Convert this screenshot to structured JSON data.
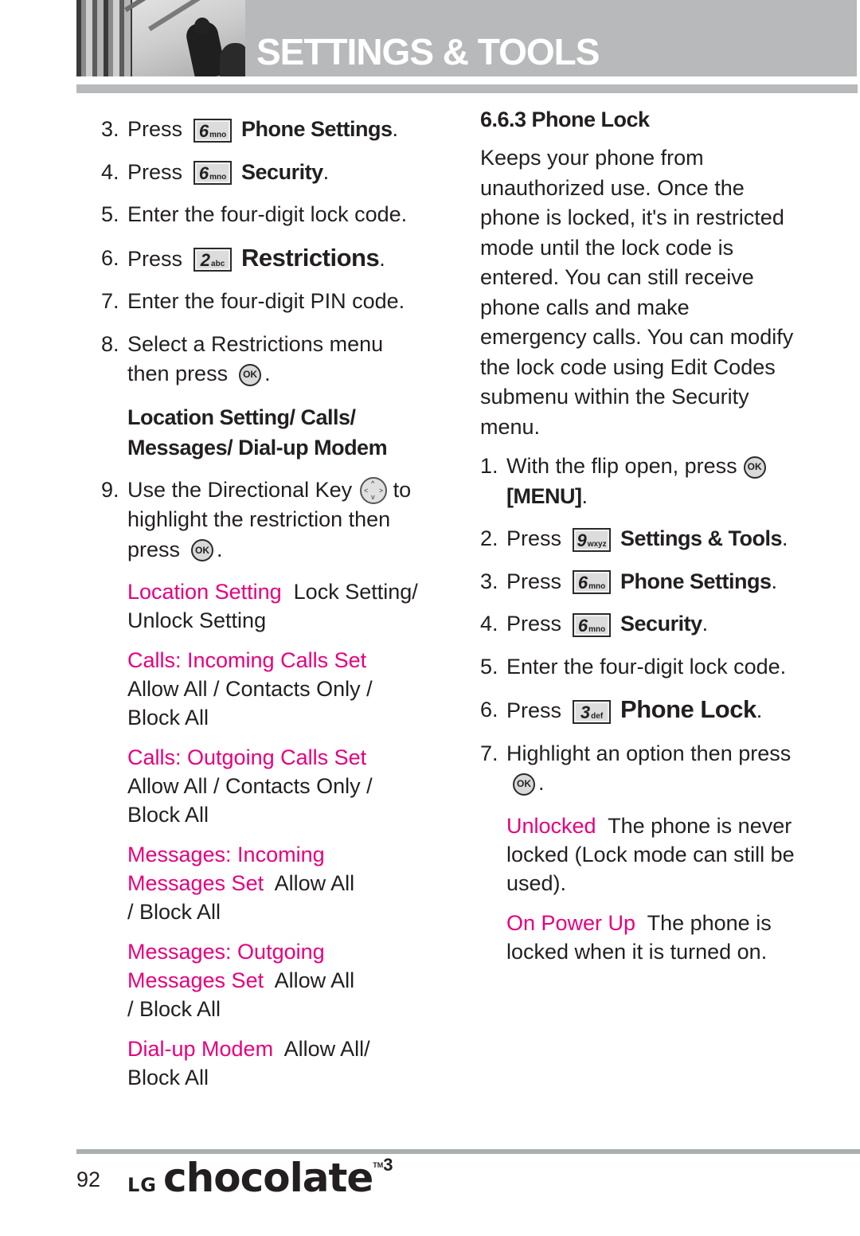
{
  "header": {
    "title": "SETTINGS & TOOLS"
  },
  "left_column": {
    "steps_a": [
      {
        "num": "3.",
        "press": "Press",
        "key_digit": "6",
        "key_letters": "mno",
        "target": "Phone Settings",
        "end": "."
      },
      {
        "num": "4.",
        "press": "Press",
        "key_digit": "6",
        "key_letters": "mno",
        "target": "Security",
        "end": "."
      }
    ],
    "step5": {
      "num": "5.",
      "text": "Enter the four-digit lock code."
    },
    "step6": {
      "num": "6.",
      "press": "Press",
      "key_digit": "2",
      "key_letters": "abc",
      "target": "Restrictions",
      "end": "."
    },
    "step7": {
      "num": "7.",
      "text": "Enter the four-digit PIN code."
    },
    "step8": {
      "num": "8.",
      "text": "Select a Restrictions menu then press",
      "ok_label": "OK",
      "end": "."
    },
    "menu_list_line1": "Location Setting/ Calls/",
    "menu_list_line2": "Messages/ Dial-up Modem",
    "step9": {
      "num": "9.",
      "text_a": "Use the Directional Key",
      "text_b": "to highlight the restriction then press",
      "ok_label": "OK",
      "end": "."
    },
    "options": [
      {
        "label": "Location Setting",
        "desc": "Lock Setting/ Unlock Setting"
      },
      {
        "label": "Calls: Incoming Calls Set",
        "desc": "Allow All / Contacts Only / Block All"
      },
      {
        "label": "Calls: Outgoing Calls Set",
        "desc": "Allow All / Contacts Only / Block All"
      },
      {
        "label": "Messages: Incoming Messages Set",
        "desc": "Allow All / Block All"
      },
      {
        "label": "Messages: Outgoing Messages Set",
        "desc": "Allow All / Block All"
      },
      {
        "label": "Dial-up Modem",
        "desc": "Allow All/ Block All"
      }
    ]
  },
  "right_column": {
    "section_title": "6.6.3 Phone Lock",
    "description": "Keeps your phone from unauthorized use. Once the phone is locked, it's in restricted mode until the lock code is entered. You can still receive phone calls and make emergency calls. You can modify the lock code using Edit Codes submenu within the Security menu.",
    "step1": {
      "num": "1.",
      "text": "With the flip open, press",
      "ok_label": "OK",
      "menu": "[MENU]",
      "end": "."
    },
    "press_steps": [
      {
        "num": "2.",
        "press": "Press",
        "key_digit": "9",
        "key_letters": "wxyz",
        "target": "Settings & Tools",
        "end": "."
      },
      {
        "num": "3.",
        "press": "Press",
        "key_digit": "6",
        "key_letters": "mno",
        "target": "Phone Settings",
        "end": "."
      },
      {
        "num": "4.",
        "press": "Press",
        "key_digit": "6",
        "key_letters": "mno",
        "target": "Security",
        "end": "."
      }
    ],
    "step5": {
      "num": "5.",
      "text": "Enter the four-digit lock code."
    },
    "step6": {
      "num": "6.",
      "press": "Press",
      "key_digit": "3",
      "key_letters": "def",
      "target": "Phone Lock",
      "end": "."
    },
    "step7": {
      "num": "7.",
      "text": "Highlight an option then press",
      "ok_label": "OK",
      "end": "."
    },
    "options": [
      {
        "label": "Unlocked",
        "desc": "The phone is never locked (Lock mode can still be used)."
      },
      {
        "label": "On Power Up",
        "desc": "The phone is locked when it is turned on."
      }
    ]
  },
  "footer": {
    "page_number": "92",
    "brand_lg": "LG",
    "brand_name": "chocolate",
    "brand_tm": "TM",
    "brand_version": "3"
  },
  "colors": {
    "accent_pink": "#e5007e",
    "header_gray": "#b8b9bb",
    "text": "#231f20"
  }
}
